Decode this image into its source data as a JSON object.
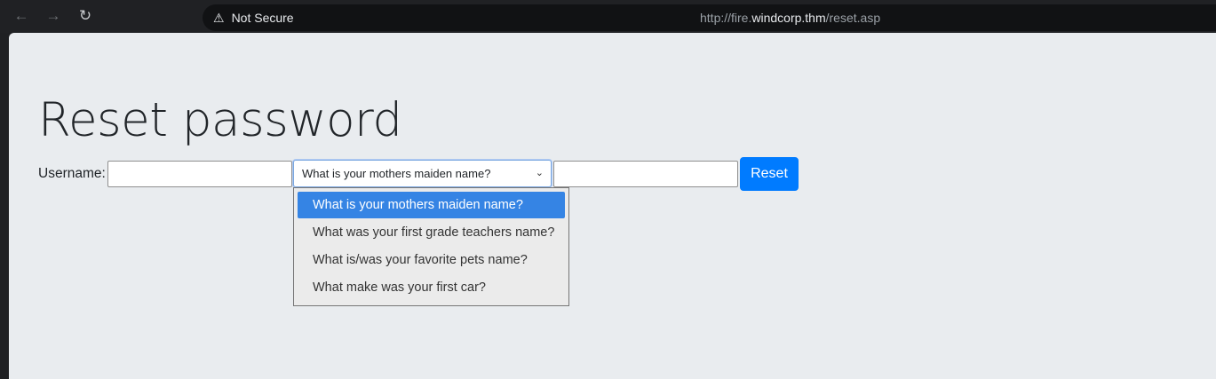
{
  "browser": {
    "nav": {
      "back_icon": "←",
      "forward_icon": "→",
      "reload_icon": "↻"
    },
    "security_icon": "⚠",
    "security_label": "Not Secure",
    "url_prefix": "http://fire.",
    "url_domain": "windcorp.thm",
    "url_path": "/reset.asp"
  },
  "page": {
    "title": "Reset password",
    "form": {
      "username_label": "Username:",
      "username_value": "",
      "question_selected": "What is your mothers maiden name?",
      "answer_value": "",
      "submit_label": "Reset",
      "question_options": [
        "What is your mothers maiden name?",
        "What was your first grade teachers name?",
        "What is/was your favorite pets name?",
        "What make was your first car?"
      ]
    }
  },
  "colors": {
    "page_background": "#e9ecef",
    "accent": "#007bff",
    "option_highlight": "#3584e4"
  }
}
